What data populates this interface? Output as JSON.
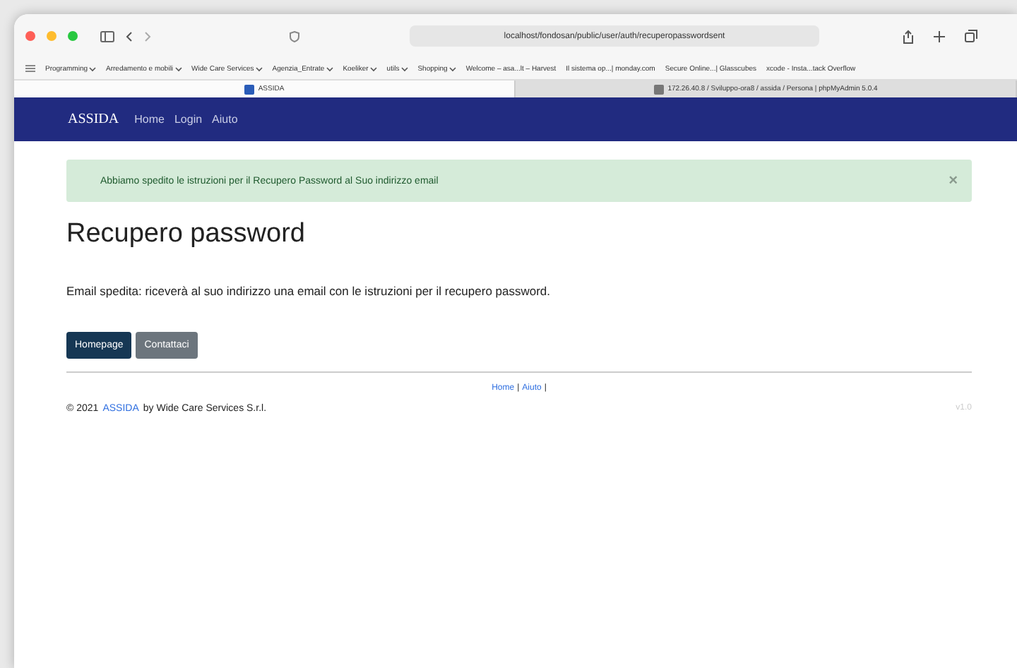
{
  "browser": {
    "url": "localhost/fondosan/public/user/auth/recuperopasswordsent",
    "bookmarks": [
      {
        "label": "Programming",
        "dropdown": true
      },
      {
        "label": "Arredamento e mobili",
        "dropdown": true
      },
      {
        "label": "Wide Care Services",
        "dropdown": true
      },
      {
        "label": "Agenzia_Entrate",
        "dropdown": true
      },
      {
        "label": "Koeliker",
        "dropdown": true
      },
      {
        "label": "utils",
        "dropdown": true
      },
      {
        "label": "Shopping",
        "dropdown": true
      },
      {
        "label": "Welcome – asa...lt – Harvest",
        "dropdown": false
      },
      {
        "label": "Il sistema op...| monday.com",
        "dropdown": false
      },
      {
        "label": "Secure Online...| Glasscubes",
        "dropdown": false
      },
      {
        "label": "xcode - Insta...tack Overflow",
        "dropdown": false
      }
    ],
    "tabs": [
      {
        "title": "ASSIDA",
        "selected": true
      },
      {
        "title": "172.26.40.8 / Sviluppo-ora8 / assida / Persona | phpMyAdmin 5.0.4",
        "selected": false
      }
    ]
  },
  "navbar": {
    "brand": "ASSIDA",
    "links": [
      "Home",
      "Login",
      "Aiuto"
    ]
  },
  "alert": {
    "message": "Abbiamo spedito le istruzioni per il Recupero Password al Suo indirizzo email",
    "close": "×"
  },
  "heading": "Recupero password",
  "body": "Email spedita: riceverà al suo indirizzo una email con le istruzioni per il recupero password.",
  "buttons": [
    {
      "label": "Homepage",
      "kind": "primary"
    },
    {
      "label": "Contattaci",
      "kind": "secondary"
    }
  ],
  "footer": {
    "links": [
      "Home",
      "Aiuto"
    ],
    "separator": "|",
    "copyright_prefix": "© 2021",
    "copyright_link": "ASSIDA",
    "copyright_suffix": "by Wide Care Services S.r.l.",
    "version": "v1.0"
  }
}
